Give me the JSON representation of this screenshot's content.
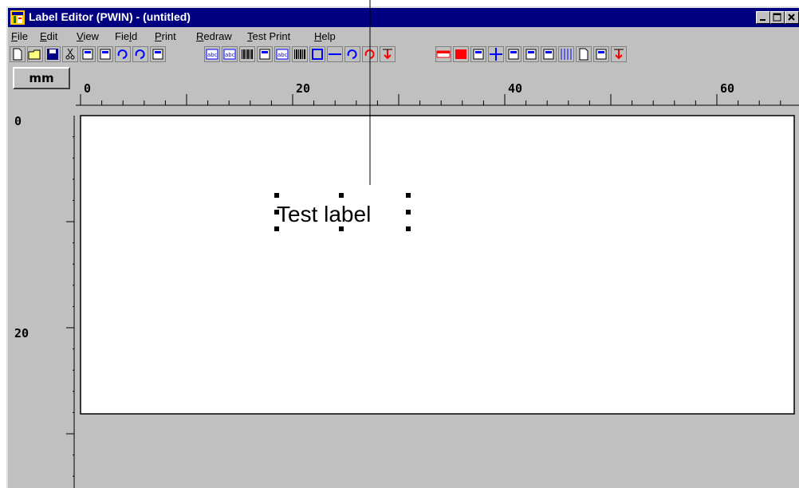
{
  "window": {
    "title": "Label Editor (PWIN) - (untitled)"
  },
  "menu": [
    {
      "label": "File",
      "key": "F"
    },
    {
      "label": "Edit",
      "key": "E"
    },
    {
      "label": "View",
      "key": "V"
    },
    {
      "label": "Field",
      "key": "l"
    },
    {
      "label": "Print",
      "key": "P"
    },
    {
      "label": "Redraw",
      "key": "R"
    },
    {
      "label": "Test Print",
      "key": "T"
    },
    {
      "label": "Help",
      "key": "H"
    }
  ],
  "ruler": {
    "unit": "mm",
    "x_labels": [
      "0",
      "20",
      "40",
      "60"
    ],
    "y_labels": [
      "0",
      "20"
    ]
  },
  "label_field": {
    "text": "Test label"
  },
  "toolbar_icons": [
    "new-icon",
    "open-icon",
    "save-icon",
    "cut-icon",
    "copy-icon",
    "paste-icon",
    "undo-icon",
    "redo-icon",
    "help-pointer-icon",
    "text-field-icon",
    "text-box-icon",
    "barcode-icon",
    "image-icon",
    "serial-text-icon",
    "serial-barcode-icon",
    "box-icon",
    "line-icon",
    "rotate-icon",
    "refresh-icon",
    "download-icon",
    "ruler-icon",
    "fill-icon",
    "zoom-icon",
    "crosshair-icon",
    "counter-icon",
    "print-setup-icon",
    "variable-icon",
    "grid-icon",
    "page-icon",
    "columns-icon",
    "send-icon"
  ],
  "colors": {
    "titlebar": "#000080",
    "face": "#c0c0c0",
    "accent_red": "#ff0000",
    "accent_blue": "#0000ff"
  }
}
